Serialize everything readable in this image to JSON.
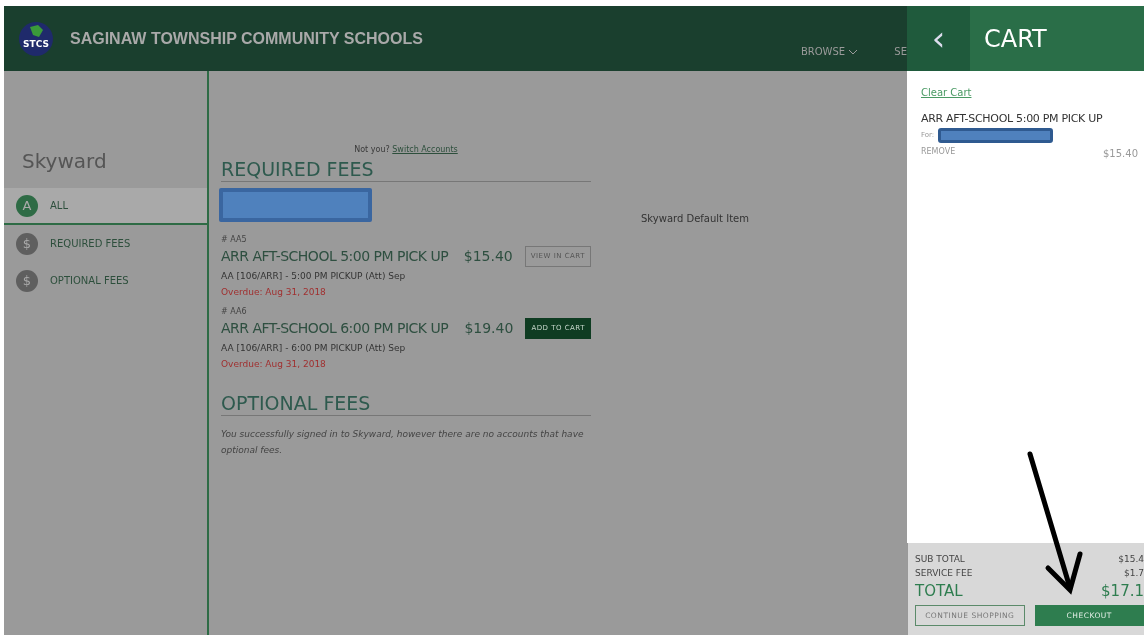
{
  "header": {
    "logo": "STCS",
    "title": "SAGINAW TOWNSHIP COMMUNITY SCHOOLS",
    "nav": [
      {
        "label": "BROWSE",
        "dropdown": true
      },
      {
        "label": "SE",
        "dropdown": false
      }
    ]
  },
  "sidebar": {
    "title": "Skyward",
    "items": [
      {
        "icon": "A",
        "label": "ALL",
        "selected": true
      },
      {
        "icon": "$",
        "label": "REQUIRED FEES",
        "selected": false
      },
      {
        "icon": "$",
        "label": "OPTIONAL FEES",
        "selected": false
      }
    ]
  },
  "account": {
    "prompt": "Not you?",
    "link": "Switch Accounts"
  },
  "default_item": "Skyward Default Item",
  "required_fees": {
    "heading": "REQUIRED FEES",
    "student_redacted": true,
    "items": [
      {
        "code": "# AA5",
        "title": "ARR AFT-SCHOOL 5:00 PM PICK UP",
        "price": "$15.40",
        "button": "VIEW IN CART",
        "in_cart": true,
        "description": "AA [106/ARR] - 5:00 PM PICKUP (Att) Sep",
        "overdue_label": "Overdue:",
        "due_date": "Aug 31, 2018"
      },
      {
        "code": "# AA6",
        "title": "ARR AFT-SCHOOL 6:00 PM PICK UP",
        "price": "$19.40",
        "button": "ADD TO CART",
        "in_cart": false,
        "description": "AA [106/ARR] - 6:00 PM PICKUP (Att) Sep",
        "overdue_label": "Overdue:",
        "due_date": "Aug 31, 2018"
      }
    ]
  },
  "optional_fees": {
    "heading": "OPTIONAL FEES",
    "message": "You successfully signed in to Skyward, however there are no accounts that have optional fees."
  },
  "cart": {
    "back": "‹",
    "title": "CART",
    "clear": "Clear Cart",
    "items": [
      {
        "title": "ARR AFT-SCHOOL 5:00 PM PICK UP",
        "for_label": "For:",
        "remove": "REMOVE",
        "price": "$15.40"
      }
    ],
    "summary": [
      {
        "label": "SUB TOTAL",
        "value": "$15.4"
      },
      {
        "label": "SERVICE FEE",
        "value": "$1.7"
      }
    ],
    "total": {
      "label": "TOTAL",
      "value": "$17.1"
    },
    "buttons": [
      {
        "label": "CONTINUE SHOPPING",
        "kind": "outline"
      },
      {
        "label": "CHECKOUT",
        "kind": "primary"
      }
    ]
  }
}
